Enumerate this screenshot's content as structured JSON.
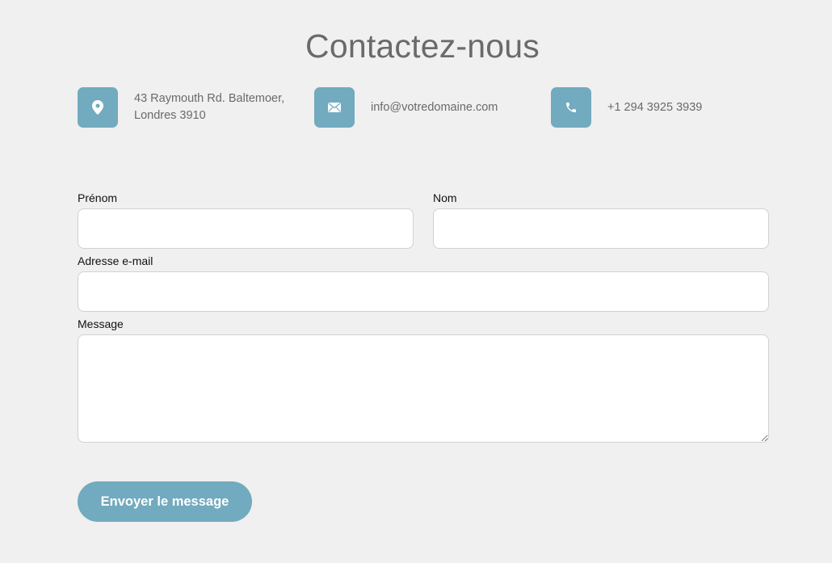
{
  "page": {
    "title": "Contactez-nous"
  },
  "contact_info": {
    "address_line1": "43 Raymouth Rd. Baltemoer,",
    "address_line2": "Londres 3910",
    "email": "info@votredomaine.com",
    "phone": "+1 294 3925 3939",
    "icons": {
      "address": "map-pin-icon",
      "email": "envelope-icon",
      "phone": "phone-icon"
    }
  },
  "form": {
    "first_name_label": "Prénom",
    "first_name_value": "",
    "last_name_label": "Nom",
    "last_name_value": "",
    "email_label": "Adresse e-mail",
    "email_value": "",
    "message_label": "Message",
    "message_value": "",
    "submit_label": "Envoyer le message"
  },
  "colors": {
    "accent": "#72aabf",
    "background": "#eff0ef",
    "title": "#6a6a6a",
    "field_border": "#cfd2d4"
  }
}
